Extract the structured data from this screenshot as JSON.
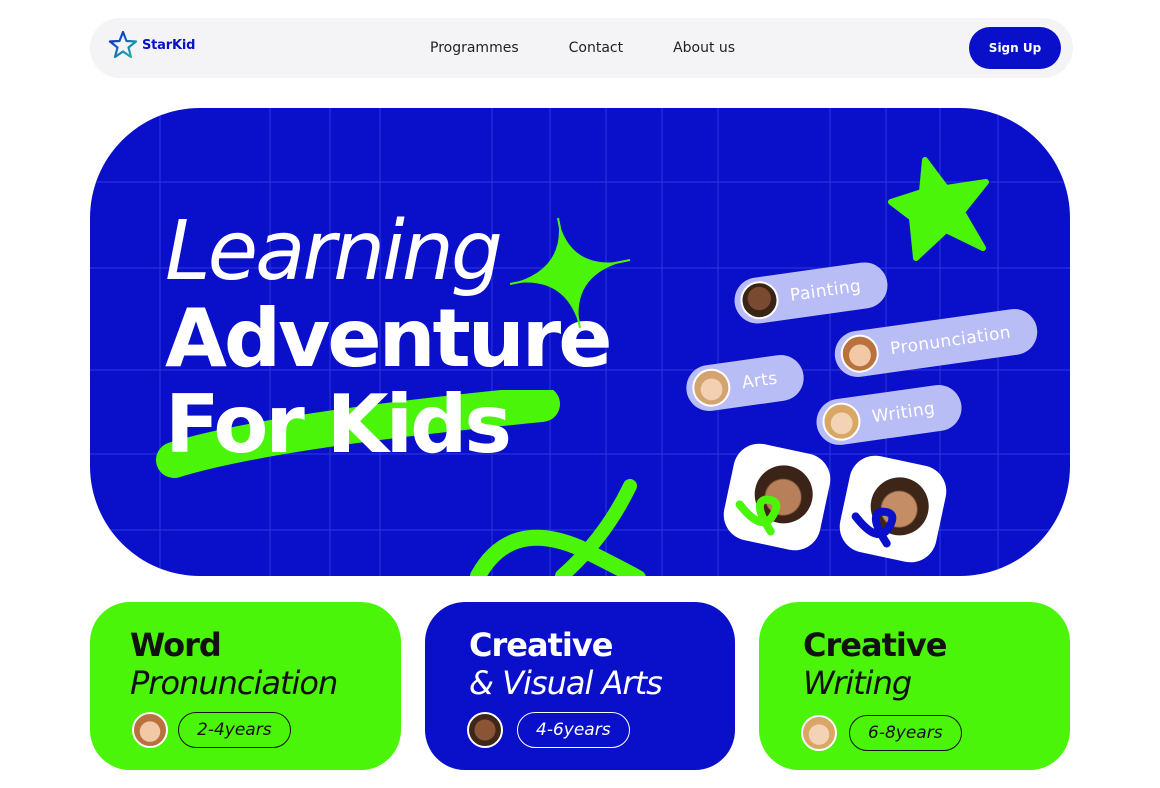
{
  "nav": {
    "brand": "StarKid",
    "links": [
      "Programmes",
      "Contact",
      "About us"
    ],
    "cta": "Sign Up"
  },
  "hero": {
    "line1": "Learning",
    "line2": "Adventure",
    "line3": "For Kids",
    "tags": [
      "Painting",
      "Pronunciation",
      "Arts",
      "Writing"
    ]
  },
  "cards": [
    {
      "title": "Word",
      "subtitle": "Pronunciation",
      "age": "2-4years"
    },
    {
      "title": "Creative",
      "subtitle": "& Visual Arts",
      "age": "4-6years"
    },
    {
      "title": "Creative",
      "subtitle": "Writing",
      "age": "6-8years"
    }
  ],
  "colors": {
    "brand_blue": "#0a0fc9",
    "accent_green": "#4bf50a",
    "tag_lavender": "#b9bdf6",
    "nav_bg": "#f4f4f6"
  },
  "icons": {
    "logo": "star-outline-icon",
    "decor": [
      "green-star-icon",
      "sparkle-icon",
      "squiggle-icon",
      "loop-icon"
    ]
  }
}
